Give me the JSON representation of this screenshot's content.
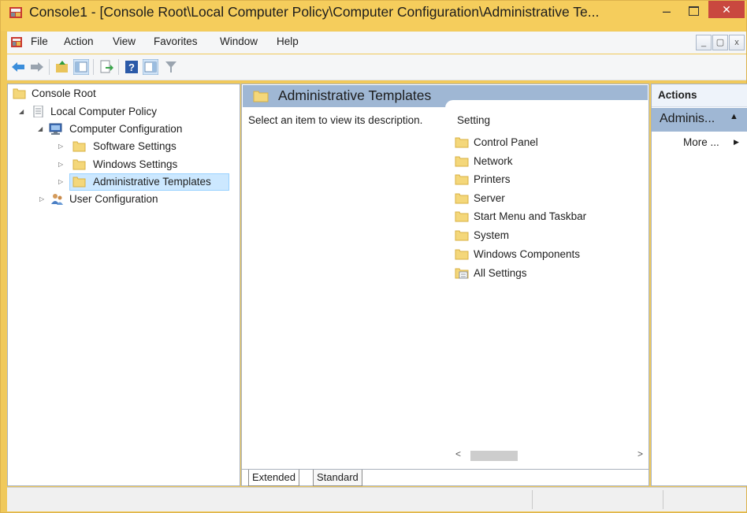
{
  "window": {
    "title": "Console1 - [Console Root\\Local Computer Policy\\Computer Configuration\\Administrative Te...",
    "minimize": "–",
    "close": "✕"
  },
  "menu": {
    "items": [
      "File",
      "Action",
      "View",
      "Favorites",
      "Window",
      "Help"
    ]
  },
  "tree": {
    "root": "Console Root",
    "lcp": "Local Computer Policy",
    "computer_config": "Computer Configuration",
    "software_settings": "Software Settings",
    "windows_settings": "Windows Settings",
    "admin_templates": "Administrative Templates",
    "user_config": "User Configuration"
  },
  "main": {
    "header": "Administrative Templates",
    "description": "Select an item to view its description.",
    "column_setting": "Setting",
    "items": [
      "Control Panel",
      "Network",
      "Printers",
      "Server",
      "Start Menu and Taskbar",
      "System",
      "Windows Components",
      "All Settings"
    ],
    "scroll_left": "<",
    "scroll_right": ">",
    "tabs": [
      "Extended",
      "Standard"
    ]
  },
  "actions": {
    "title": "Actions",
    "section": "Adminis...",
    "more": "More ..."
  },
  "colors": {
    "titlebar": "#f5cd5c",
    "header_band": "#9fb7d4",
    "close_button": "#c9483f",
    "selection": "#cce8ff"
  }
}
